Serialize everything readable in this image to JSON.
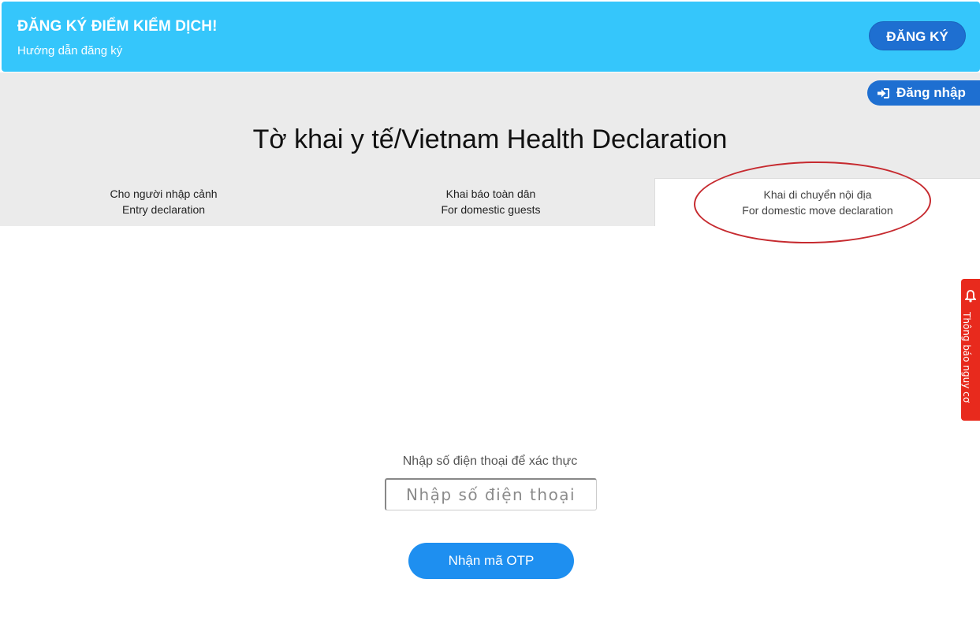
{
  "banner": {
    "title": "ĐĂNG KÝ ĐIỂM KIỂM DỊCH!",
    "subtitle": "Hướng dẫn đăng ký",
    "register_label": "ĐĂNG KÝ",
    "color": "#35c6fb"
  },
  "header": {
    "login_label": "Đăng nhập",
    "login_icon": "sign-in-icon",
    "title": "Tờ khai y tế/Vietnam Health Declaration"
  },
  "tabs": [
    {
      "line1": "Cho người nhập cảnh",
      "line2": "Entry declaration"
    },
    {
      "line1": "Khai báo toàn dân",
      "line2": "For domestic guests"
    },
    {
      "line1": "Khai di chuyển nội địa",
      "line2": "For domestic move declaration",
      "active": true
    }
  ],
  "side_tab": {
    "label": "Thông báo nguy cơ",
    "icon": "bell-icon",
    "color": "#e82a1d"
  },
  "verify": {
    "label": "Nhập số điện thoại để xác thực",
    "phone_placeholder": "Nhập số điện thoại",
    "phone_value": "",
    "otp_button": "Nhận mã OTP"
  },
  "colors": {
    "primary": "#1e6fd1",
    "otp": "#1e8ff0",
    "highlight": "#c62a2f"
  }
}
